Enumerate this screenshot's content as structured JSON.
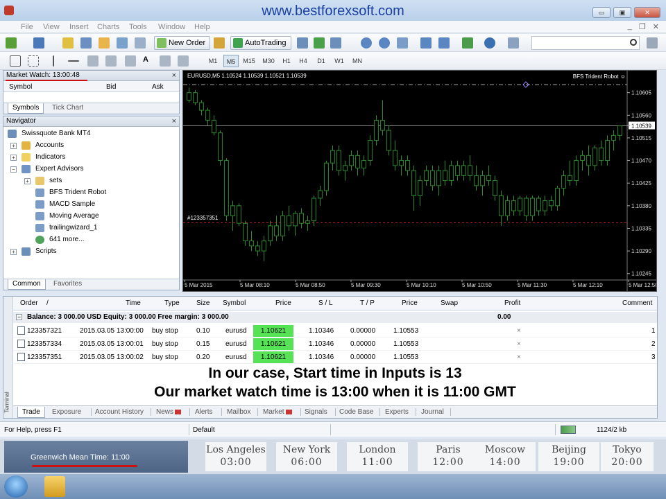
{
  "window": {
    "site_title": "www.bestforexsoft.com",
    "btn_min": "▭",
    "btn_max": "▣",
    "btn_close": "✕"
  },
  "menu": {
    "items": [
      "File",
      "View",
      "Insert",
      "Charts",
      "Tools",
      "Window",
      "Help"
    ]
  },
  "toolbar": {
    "new_order": "New Order",
    "autotrading": "AutoTrading",
    "timeframes": [
      "M1",
      "M5",
      "M15",
      "M30",
      "H1",
      "H4",
      "D1",
      "W1",
      "MN"
    ],
    "active_timeframe": "M5"
  },
  "market_watch": {
    "title": "Market Watch: 13:00:48",
    "col_symbol": "Symbol",
    "col_bid": "Bid",
    "col_ask": "Ask",
    "tab_symbols": "Symbols",
    "tab_tick_chart": "Tick Chart"
  },
  "navigator": {
    "title": "Navigator",
    "items": [
      {
        "label": "Swissquote Bank MT4",
        "icon": "terminal-icon"
      },
      {
        "label": "Accounts",
        "icon": "accounts-icon"
      },
      {
        "label": "Indicators",
        "icon": "indicators-icon"
      },
      {
        "label": "Expert Advisors",
        "icon": "expert-advisors-icon"
      },
      {
        "label": "sets",
        "icon": "folder-icon"
      },
      {
        "label": "BFS Trident Robot",
        "icon": "robot-icon"
      },
      {
        "label": "MACD Sample",
        "icon": "robot-icon"
      },
      {
        "label": "Moving Average",
        "icon": "robot-icon"
      },
      {
        "label": "trailingwizard_1",
        "icon": "robot-icon"
      },
      {
        "label": "641 more...",
        "icon": "globe-icon"
      },
      {
        "label": "Scripts",
        "icon": "scripts-icon"
      }
    ],
    "tab_common": "Common",
    "tab_favorites": "Favorites"
  },
  "chart": {
    "symbol_info": "EURUSD,M5  1.10524 1.10539 1.10521 1.10539",
    "ea_label": "BFS Trident Robot ☺",
    "order_label": "#123357351",
    "price_levels": [
      "1.10605",
      "1.10560",
      "1.10539",
      "1.10515",
      "1.10470",
      "1.10425",
      "1.10380",
      "1.10335",
      "1.10290",
      "1.10245"
    ],
    "current_price": 1.10539,
    "pending_level": 1.10346,
    "upper_level": 1.10621,
    "time_labels": [
      "5 Mar 2015",
      "5 Mar 08:10",
      "5 Mar 08:50",
      "5 Mar 09:30",
      "5 Mar 10:10",
      "5 Mar 10:50",
      "5 Mar 11:30",
      "5 Mar 12:10",
      "5 Mar 12:50"
    ],
    "bullish_color": "#ffffff",
    "bearish_color": "#2e8b2e",
    "bars": [
      [
        1.1059,
        1.10615,
        1.10585,
        1.10605
      ],
      [
        1.10605,
        1.1061,
        1.1058,
        1.10585
      ],
      [
        1.10585,
        1.1059,
        1.1056,
        1.1057
      ],
      [
        1.1057,
        1.10575,
        1.1054,
        1.1055
      ],
      [
        1.1055,
        1.1056,
        1.1052,
        1.10525
      ],
      [
        1.10525,
        1.1053,
        1.1046,
        1.1047
      ],
      [
        1.1047,
        1.10475,
        1.1035,
        1.1036
      ],
      [
        1.1036,
        1.1039,
        1.1033,
        1.1038
      ],
      [
        1.1038,
        1.10385,
        1.1034,
        1.10345
      ],
      [
        1.10345,
        1.1035,
        1.103,
        1.1031
      ],
      [
        1.1031,
        1.1033,
        1.1029,
        1.103
      ],
      [
        1.103,
        1.1031,
        1.1028,
        1.1029
      ],
      [
        1.1029,
        1.1032,
        1.1027,
        1.1031
      ],
      [
        1.1031,
        1.1035,
        1.103,
        1.1034
      ],
      [
        1.1034,
        1.1036,
        1.1031,
        1.1032
      ],
      [
        1.1032,
        1.1037,
        1.1031,
        1.1036
      ],
      [
        1.1036,
        1.1038,
        1.1033,
        1.1034
      ],
      [
        1.1034,
        1.1037,
        1.1032,
        1.10365
      ],
      [
        1.10365,
        1.10375,
        1.10335,
        1.10345
      ],
      [
        1.10345,
        1.1036,
        1.1033,
        1.1035
      ],
      [
        1.1035,
        1.104,
        1.1034,
        1.10395
      ],
      [
        1.10395,
        1.1042,
        1.1038,
        1.1041
      ],
      [
        1.1041,
        1.1047,
        1.104,
        1.10465
      ],
      [
        1.10465,
        1.105,
        1.1045,
        1.1049
      ],
      [
        1.1049,
        1.105,
        1.1044,
        1.1045
      ],
      [
        1.1045,
        1.1047,
        1.1043,
        1.1046
      ],
      [
        1.1046,
        1.1049,
        1.1045,
        1.1048
      ],
      [
        1.1048,
        1.1049,
        1.1044,
        1.10455
      ],
      [
        1.10455,
        1.1048,
        1.1044,
        1.1047
      ],
      [
        1.1047,
        1.1052,
        1.1046,
        1.1051
      ],
      [
        1.1051,
        1.1056,
        1.105,
        1.1055
      ],
      [
        1.1055,
        1.1059,
        1.1052,
        1.1053
      ],
      [
        1.1053,
        1.1054,
        1.1048,
        1.1049
      ],
      [
        1.1049,
        1.1051,
        1.1045,
        1.1046
      ],
      [
        1.1046,
        1.1048,
        1.1044,
        1.1047
      ],
      [
        1.1047,
        1.1048,
        1.1044,
        1.1045
      ],
      [
        1.1045,
        1.1046,
        1.1037,
        1.104
      ],
      [
        1.104,
        1.1044,
        1.1038,
        1.1043
      ],
      [
        1.1043,
        1.1046,
        1.1042,
        1.1045
      ],
      [
        1.1045,
        1.1046,
        1.1041,
        1.1042
      ],
      [
        1.1042,
        1.1046,
        1.104,
        1.1045
      ],
      [
        1.1045,
        1.1047,
        1.1042,
        1.1043
      ],
      [
        1.1043,
        1.1047,
        1.1042,
        1.1046
      ],
      [
        1.1046,
        1.1047,
        1.1043,
        1.1044
      ],
      [
        1.1044,
        1.1047,
        1.1043,
        1.1046
      ],
      [
        1.1046,
        1.1048,
        1.1043,
        1.1044
      ],
      [
        1.1044,
        1.1046,
        1.1041,
        1.1042
      ],
      [
        1.1042,
        1.1045,
        1.104,
        1.1044
      ],
      [
        1.1044,
        1.1046,
        1.1042,
        1.1043
      ],
      [
        1.1043,
        1.1044,
        1.1039,
        1.104
      ],
      [
        1.104,
        1.1041,
        1.1034,
        1.1036
      ],
      [
        1.1036,
        1.104,
        1.1035,
        1.1039
      ],
      [
        1.1039,
        1.104,
        1.1036,
        1.1037
      ],
      [
        1.1037,
        1.104,
        1.1036,
        1.10395
      ],
      [
        1.10395,
        1.104,
        1.1035,
        1.1036
      ],
      [
        1.1036,
        1.104,
        1.1035,
        1.10395
      ],
      [
        1.10395,
        1.104,
        1.1036,
        1.1037
      ],
      [
        1.1037,
        1.104,
        1.1036,
        1.1039
      ],
      [
        1.1039,
        1.104,
        1.1037,
        1.1038
      ],
      [
        1.1038,
        1.1042,
        1.1037,
        1.10415
      ],
      [
        1.10415,
        1.1045,
        1.104,
        1.1044
      ],
      [
        1.1044,
        1.1047,
        1.1042,
        1.1043
      ],
      [
        1.1043,
        1.1048,
        1.1042,
        1.1047
      ],
      [
        1.1047,
        1.1049,
        1.1045,
        1.1048
      ],
      [
        1.1048,
        1.105,
        1.1044,
        1.1046
      ],
      [
        1.1046,
        1.105,
        1.1045,
        1.10495
      ],
      [
        1.10495,
        1.1051,
        1.1046,
        1.1047
      ],
      [
        1.1047,
        1.1052,
        1.1046,
        1.1051
      ],
      [
        1.1051,
        1.1053,
        1.1049,
        1.1052
      ],
      [
        1.1052,
        1.1054,
        1.1051,
        1.10539
      ]
    ]
  },
  "terminal": {
    "sidebar_label": "Terminal",
    "columns": [
      "Order",
      "/",
      "Time",
      "Type",
      "Size",
      "Symbol",
      "Price",
      "S / L",
      "T / P",
      "Price",
      "Swap",
      "Profit",
      "Comment"
    ],
    "balance_text": "Balance: 3 000.00 USD  Equity: 3 000.00  Free margin: 3 000.00",
    "balance_profit": "0.00",
    "orders": [
      {
        "order": "123357321",
        "time": "2015.03.05 13:00:00",
        "type": "buy stop",
        "size": "0.10",
        "symbol": "eurusd",
        "price": "1.10621",
        "sl": "1.10346",
        "tp": "0.00000",
        "cur_price": "1.10553",
        "close": "×",
        "comment": "1"
      },
      {
        "order": "123357334",
        "time": "2015.03.05 13:00:01",
        "type": "buy stop",
        "size": "0.15",
        "symbol": "eurusd",
        "price": "1.10621",
        "sl": "1.10346",
        "tp": "0.00000",
        "cur_price": "1.10553",
        "close": "×",
        "comment": "2"
      },
      {
        "order": "123357351",
        "time": "2015.03.05 13:00:02",
        "type": "buy stop",
        "size": "0.20",
        "symbol": "eurusd",
        "price": "1.10621",
        "sl": "1.10346",
        "tp": "0.00000",
        "cur_price": "1.10553",
        "close": "×",
        "comment": "3"
      }
    ],
    "caption_line1": "In our case, Start time in Inputs is 13",
    "caption_line2": "Our market watch time is 13:00 when it is 11:00 GMT",
    "tabs": [
      "Trade",
      "Exposure",
      "Account History",
      "News",
      "Alerts",
      "Mailbox",
      "Market",
      "Signals",
      "Code Base",
      "Experts",
      "Journal"
    ]
  },
  "statusbar": {
    "help": "For Help, press F1",
    "profile": "Default",
    "traffic": "1124/2 kb"
  },
  "clocks": {
    "gmt_label": "Greenwich Mean Time: 11:00",
    "cities": [
      {
        "name": "Los Angeles",
        "time": "03:00"
      },
      {
        "name": "New York",
        "time": "06:00"
      },
      {
        "name": "London",
        "time": "11:00"
      },
      {
        "name": "Paris",
        "time": "12:00"
      },
      {
        "name": "Moscow",
        "time": "14:00"
      },
      {
        "name": "Beijing",
        "time": "19:00"
      },
      {
        "name": "Tokyo",
        "time": "20:00"
      }
    ]
  }
}
